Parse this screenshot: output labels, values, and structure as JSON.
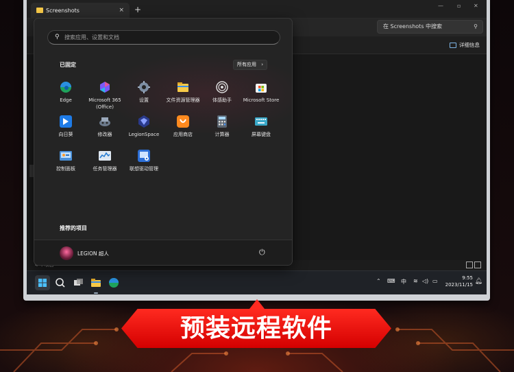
{
  "window": {
    "tab_title": "Screenshots",
    "tab_close": "×",
    "new_tab": "+",
    "minimize": "—",
    "maximize": "▫",
    "close": "✕",
    "search_placeholder": "在 Screenshots 中搜索",
    "details_label": "详细信息",
    "status_text": "4 个项目"
  },
  "start_menu": {
    "search_placeholder": "搜索应用、设置和文档",
    "pinned_title": "已固定",
    "all_apps_label": "所有应用",
    "recommended_title": "推荐的项目",
    "user_name": "LEGION 超人",
    "pinned": [
      {
        "label": "Edge",
        "icon": "edge-icon"
      },
      {
        "label": "Microsoft 365 (Office)",
        "icon": "m365-icon"
      },
      {
        "label": "设置",
        "icon": "settings-icon"
      },
      {
        "label": "文件资源管理器",
        "icon": "file-explorer-icon"
      },
      {
        "label": "体感助手",
        "icon": "motion-assistant-icon"
      },
      {
        "label": "Microsoft Store",
        "icon": "store-icon"
      },
      {
        "label": "向日葵",
        "icon": "sunlogin-icon"
      },
      {
        "label": "修改器",
        "icon": "trainer-icon"
      },
      {
        "label": "LegionSpace",
        "icon": "legionspace-icon"
      },
      {
        "label": "应用商店",
        "icon": "app-store-icon"
      },
      {
        "label": "计算器",
        "icon": "calculator-icon"
      },
      {
        "label": "屏幕键盘",
        "icon": "onscreen-keyboard-icon"
      },
      {
        "label": "控制面板",
        "icon": "control-panel-icon"
      },
      {
        "label": "任务管理器",
        "icon": "task-manager-icon"
      },
      {
        "label": "联想驱动管理",
        "icon": "lenovo-driver-icon"
      }
    ]
  },
  "taskbar": {
    "ime_label": "中",
    "time": "9:55",
    "date": "2023/11/15"
  },
  "banner": {
    "text": "预装远程软件"
  },
  "colors": {
    "banner_red": "#ff2a20",
    "accent_blue": "#3a8ee6"
  }
}
